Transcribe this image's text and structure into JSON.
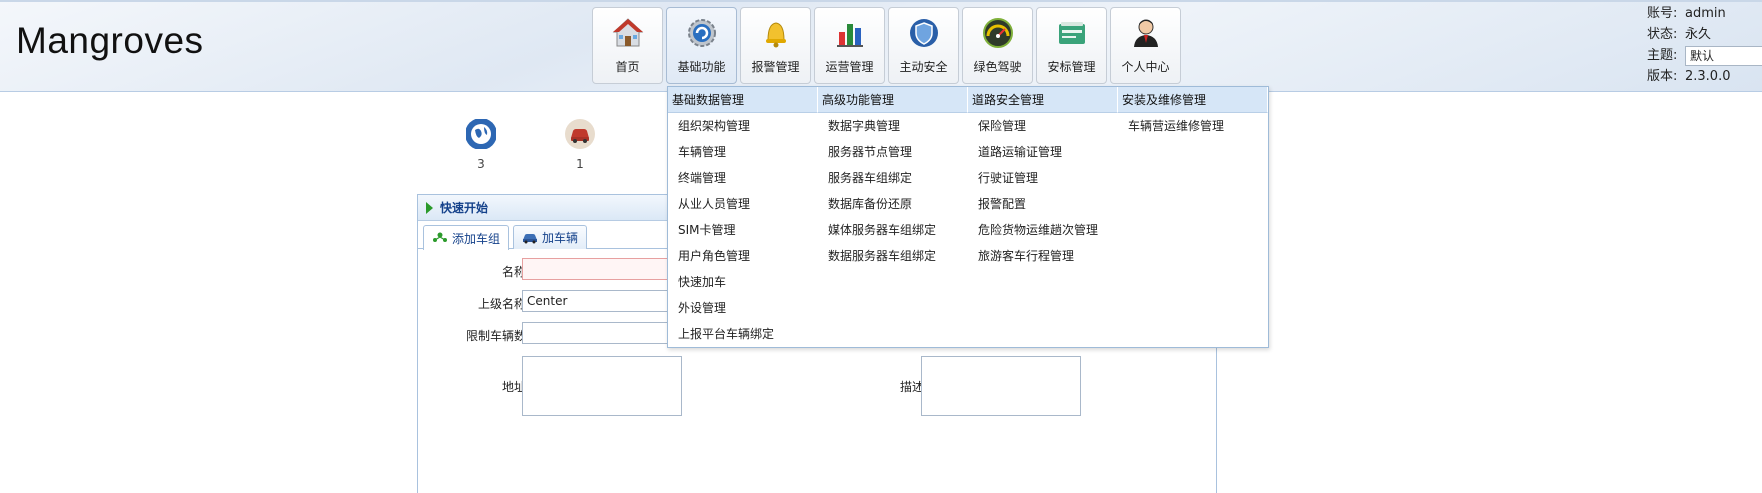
{
  "brand": "Mangroves",
  "nav": [
    {
      "label": "首页",
      "icon": "house-icon"
    },
    {
      "label": "基础功能",
      "icon": "gear-icon"
    },
    {
      "label": "报警管理",
      "icon": "alarm-bell-icon"
    },
    {
      "label": "运营管理",
      "icon": "bar-chart-icon"
    },
    {
      "label": "主动安全",
      "icon": "shield-icon"
    },
    {
      "label": "绿色驾驶",
      "icon": "speedometer-icon"
    },
    {
      "label": "安标管理",
      "icon": "certificate-icon"
    },
    {
      "label": "个人中心",
      "icon": "person-icon"
    }
  ],
  "account": {
    "account_label": "账号:",
    "account_value": "admin",
    "status_label": "状态:",
    "status_value": "永久",
    "theme_label": "主题:",
    "theme_value": "默认",
    "version_label": "版本:",
    "version_value": "2.3.0.0"
  },
  "shortcuts": [
    {
      "icon": "globe-icon",
      "count": "3"
    },
    {
      "icon": "car-icon",
      "count": "1"
    }
  ],
  "panel": {
    "title": "快速开始",
    "tabs": [
      {
        "label": "添加车组",
        "icon": "group-icon"
      },
      {
        "label": "加车辆",
        "icon": "car-icon"
      }
    ],
    "fields": {
      "name_label": "名称:",
      "name_value": "",
      "parent_label": "上级名称:",
      "parent_value": "Center",
      "limit_label": "限制车辆数:",
      "limit_value": "",
      "address_label": "地址:",
      "description_label": "描述:"
    }
  },
  "menu": {
    "columns": [
      {
        "title": "基础数据管理",
        "items": [
          "组织架构管理",
          "车辆管理",
          "终端管理",
          "从业人员管理",
          "SIM卡管理",
          "用户角色管理",
          "快速加车",
          "外设管理",
          "上报平台车辆绑定"
        ]
      },
      {
        "title": "高级功能管理",
        "items": [
          "数据字典管理",
          "服务器节点管理",
          "服务器车组绑定",
          "数据库备份还原",
          "媒体服务器车组绑定",
          "数据服务器车组绑定"
        ]
      },
      {
        "title": "道路安全管理",
        "items": [
          "保险管理",
          "道路运输证管理",
          "行驶证管理",
          "报警配置",
          "危险货物运维趟次管理",
          "旅游客车行程管理"
        ]
      },
      {
        "title": "安装及维修管理",
        "items": [
          "车辆营运维修管理"
        ]
      }
    ]
  },
  "colors": {
    "accent": "#15428b",
    "header_bg": "#dfe8f3",
    "menu_head_bg": "#d6e6f7"
  }
}
